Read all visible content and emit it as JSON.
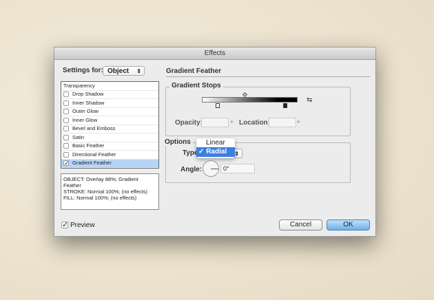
{
  "title": "Effects",
  "settings_for": {
    "label": "Settings for:",
    "value": "Object"
  },
  "effects": [
    {
      "label": "Transparency",
      "checkbox": false
    },
    {
      "label": "Drop Shadow",
      "checkbox": true,
      "checked": false
    },
    {
      "label": "Inner Shadow",
      "checkbox": true,
      "checked": false
    },
    {
      "label": "Outer Glow",
      "checkbox": true,
      "checked": false
    },
    {
      "label": "Inner Glow",
      "checkbox": true,
      "checked": false
    },
    {
      "label": "Bevel and Emboss",
      "checkbox": true,
      "checked": false
    },
    {
      "label": "Satin",
      "checkbox": true,
      "checked": false
    },
    {
      "label": "Basic Feather",
      "checkbox": true,
      "checked": false
    },
    {
      "label": "Directional Feather",
      "checkbox": true,
      "checked": false
    },
    {
      "label": "Gradient Feather",
      "checkbox": true,
      "checked": true,
      "selected": true
    }
  ],
  "description": [
    "OBJECT: Overlay 88%; Gradient Feather",
    "STROKE: Normal 100%; (no effects)",
    "FILL: Normal 100%; (no effects)"
  ],
  "panel": {
    "title": "Gradient Feather",
    "stops_group": "Gradient Stops",
    "opacity_label": "Opacity:",
    "opacity_value": "",
    "location_label": "Location:",
    "location_value": "",
    "options_group": "Options",
    "type_label": "Type:",
    "type_options": [
      "Linear",
      "Radial"
    ],
    "type_selected": "Radial",
    "angle_label": "Angle:",
    "angle_value": "0°"
  },
  "preview": {
    "label": "Preview",
    "checked": true
  },
  "buttons": {
    "cancel": "Cancel",
    "ok": "OK"
  },
  "colors": {
    "accent": "#3b7fe0",
    "selected_row": "#b6d4f5"
  }
}
